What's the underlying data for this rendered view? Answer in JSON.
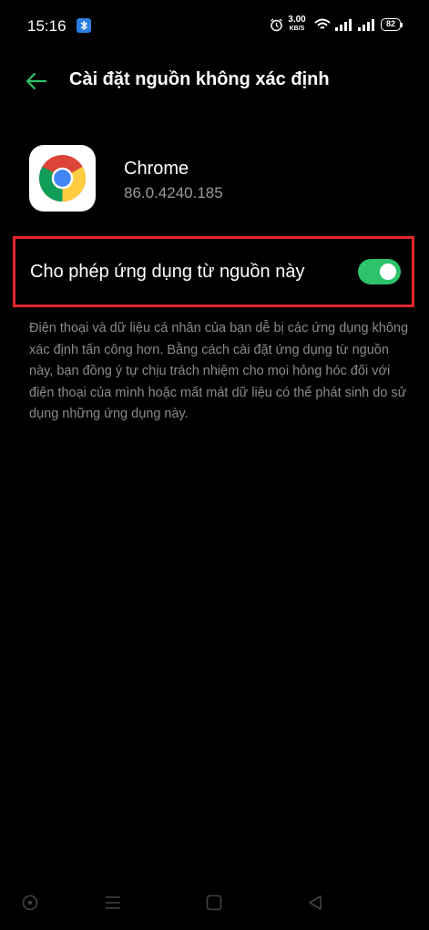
{
  "status_bar": {
    "time": "15:16",
    "network_speed_value": "3.00",
    "network_speed_unit": "KB/S",
    "battery_level": "82"
  },
  "header": {
    "title": "Cài đặt nguồn không xác định",
    "back_icon": "arrow-left-icon"
  },
  "app": {
    "name": "Chrome",
    "version": "86.0.4240.185",
    "icon": "chrome-icon"
  },
  "setting": {
    "label": "Cho phép ứng dụng từ nguồn này",
    "enabled": true,
    "toggle_color": "#2dc36a",
    "highlight_color": "#e3262d"
  },
  "description": "Điện thoại và dữ liệu cá nhân của bạn dễ bị các ứng dụng không xác định tấn công hơn. Bằng cách cài đặt ứng dụng từ nguồn này, bạn đồng ý tự chịu trách nhiệm cho mọi hỏng hóc đối với điện thoại của mình hoặc mất mát dữ liệu có thể phát sinh do sử dụng những ứng dụng này.",
  "nav_bar": {
    "items": [
      "assistant-icon",
      "menu-icon",
      "home-icon",
      "back-icon"
    ]
  },
  "colors": {
    "accent": "#2dc36a",
    "background": "#000000"
  }
}
